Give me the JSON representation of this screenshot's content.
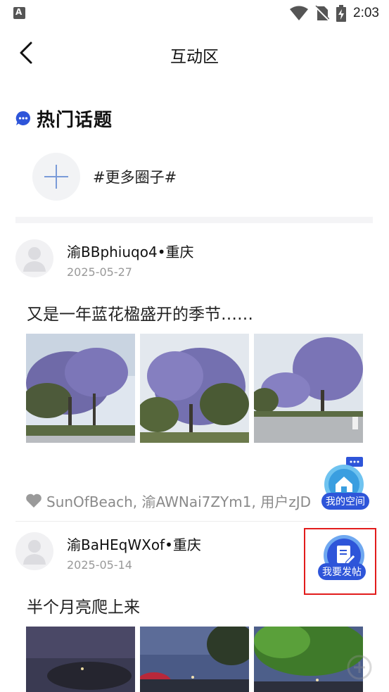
{
  "status_bar": {
    "time": "2:03",
    "app_badge": "A"
  },
  "header": {
    "title": "互动区"
  },
  "hot_topics": {
    "title": "热门话题",
    "more_label": "#更多圈子#"
  },
  "posts": [
    {
      "author": "渝BBphiuqo4•重庆",
      "date": "2025-05-27",
      "text": "又是一年蓝花楹盛开的季节……",
      "likes": "SunOfBeach, 渝AWNai7ZYm1, 用户zJD"
    },
    {
      "author": "渝BaHEqWXof•重庆",
      "date": "2025-05-14",
      "text": "半个月亮爬上来"
    }
  ],
  "floating": {
    "my_space_label": "我的空间",
    "post_label": "我要发帖"
  },
  "colors": {
    "accent": "#2e55d9",
    "highlight": "#e21c1c"
  }
}
